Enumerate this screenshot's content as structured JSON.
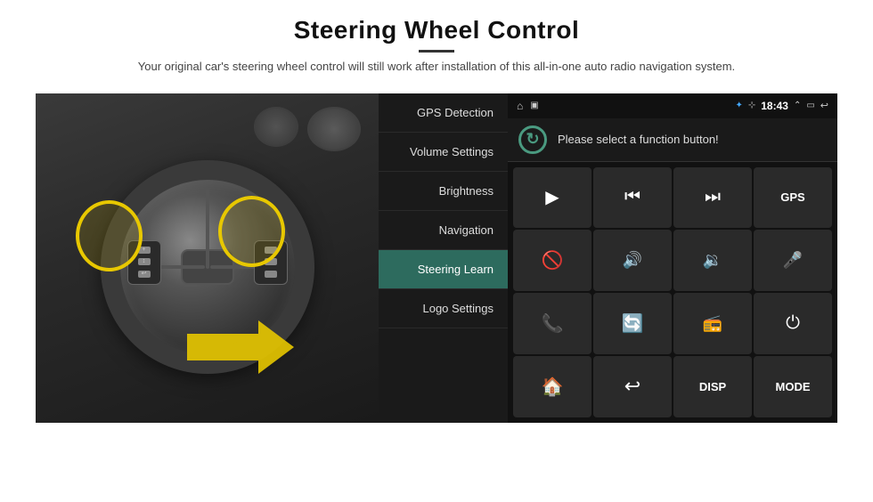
{
  "header": {
    "title": "Steering Wheel Control",
    "subtitle": "Your original car's steering wheel control will still work after installation of this all-in-one auto radio navigation system."
  },
  "status_bar": {
    "time": "18:43",
    "icons_left": [
      "home",
      "photo"
    ],
    "icons_right": [
      "bluetooth",
      "wifi",
      "signal",
      "arrow-up",
      "window",
      "back"
    ]
  },
  "menu": {
    "items": [
      {
        "id": "gps",
        "label": "GPS Detection",
        "active": false
      },
      {
        "id": "volume",
        "label": "Volume Settings",
        "active": false
      },
      {
        "id": "brightness",
        "label": "Brightness",
        "active": false
      },
      {
        "id": "navigation",
        "label": "Navigation",
        "active": false
      },
      {
        "id": "steering",
        "label": "Steering Learn",
        "active": true
      },
      {
        "id": "logo",
        "label": "Logo Settings",
        "active": false
      }
    ]
  },
  "control_panel": {
    "prompt": "Please select a function button!",
    "refresh_label": "↻",
    "buttons": [
      {
        "id": "play",
        "symbol": "▶",
        "type": "icon"
      },
      {
        "id": "prev",
        "symbol": "⏮",
        "type": "icon"
      },
      {
        "id": "next",
        "symbol": "⏭",
        "type": "icon"
      },
      {
        "id": "gps",
        "symbol": "GPS",
        "type": "text"
      },
      {
        "id": "mute",
        "symbol": "🚫",
        "type": "icon"
      },
      {
        "id": "vol-up",
        "symbol": "🔊+",
        "type": "icon"
      },
      {
        "id": "vol-down",
        "symbol": "🔉-",
        "type": "icon"
      },
      {
        "id": "mic",
        "symbol": "🎤",
        "type": "icon"
      },
      {
        "id": "phone",
        "symbol": "📞",
        "type": "icon"
      },
      {
        "id": "rotate",
        "symbol": "🔄",
        "type": "icon"
      },
      {
        "id": "radio",
        "symbol": "📻",
        "type": "icon"
      },
      {
        "id": "power",
        "symbol": "⏻",
        "type": "icon"
      },
      {
        "id": "home",
        "symbol": "🏠",
        "type": "icon"
      },
      {
        "id": "back-nav",
        "symbol": "↩",
        "type": "icon"
      },
      {
        "id": "disp",
        "symbol": "DISP",
        "type": "text"
      },
      {
        "id": "mode",
        "symbol": "MODE",
        "type": "text"
      }
    ]
  }
}
